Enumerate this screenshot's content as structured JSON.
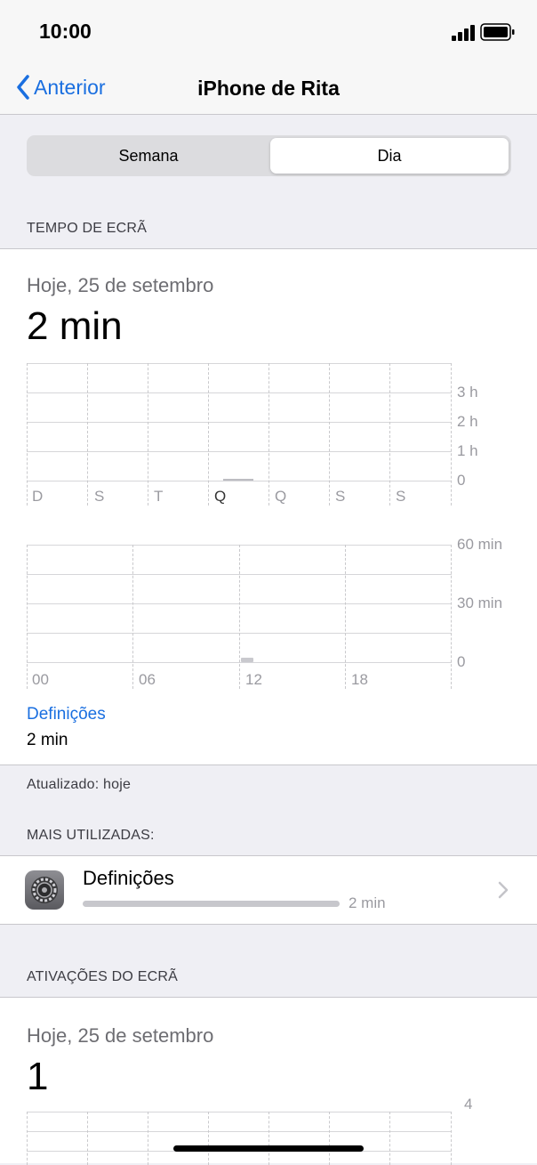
{
  "status": {
    "time": "10:00"
  },
  "nav": {
    "back_label": "Anterior",
    "title": "iPhone de Rita"
  },
  "segmented": {
    "option1": "Semana",
    "option2": "Dia",
    "selected": "Dia"
  },
  "screen_time": {
    "section_label": "TEMPO DE ECRÃ",
    "date_label": "Hoje, 25 de setembro",
    "total": "2 min",
    "weekly_axis": [
      "3 h",
      "2 h",
      "1 h",
      "0"
    ],
    "weekly_days": [
      "D",
      "S",
      "T",
      "Q",
      "Q",
      "S",
      "S"
    ],
    "hourly_axis": [
      "60 min",
      "30 min",
      "0"
    ],
    "hourly_ticks": [
      "00",
      "06",
      "12",
      "18"
    ],
    "category_label": "Definições",
    "category_value": "2 min"
  },
  "updated": "Atualizado: hoje",
  "most_used": {
    "section_label": "MAIS UTILIZADAS:",
    "app_name": "Definições",
    "app_time": "2 min",
    "app_icon": "settings-gear-icon"
  },
  "pickups": {
    "section_label": "ATIVAÇÕES DO ECRÃ",
    "date_label": "Hoje, 25 de setembro",
    "total": "1",
    "axis_top": "4"
  }
}
